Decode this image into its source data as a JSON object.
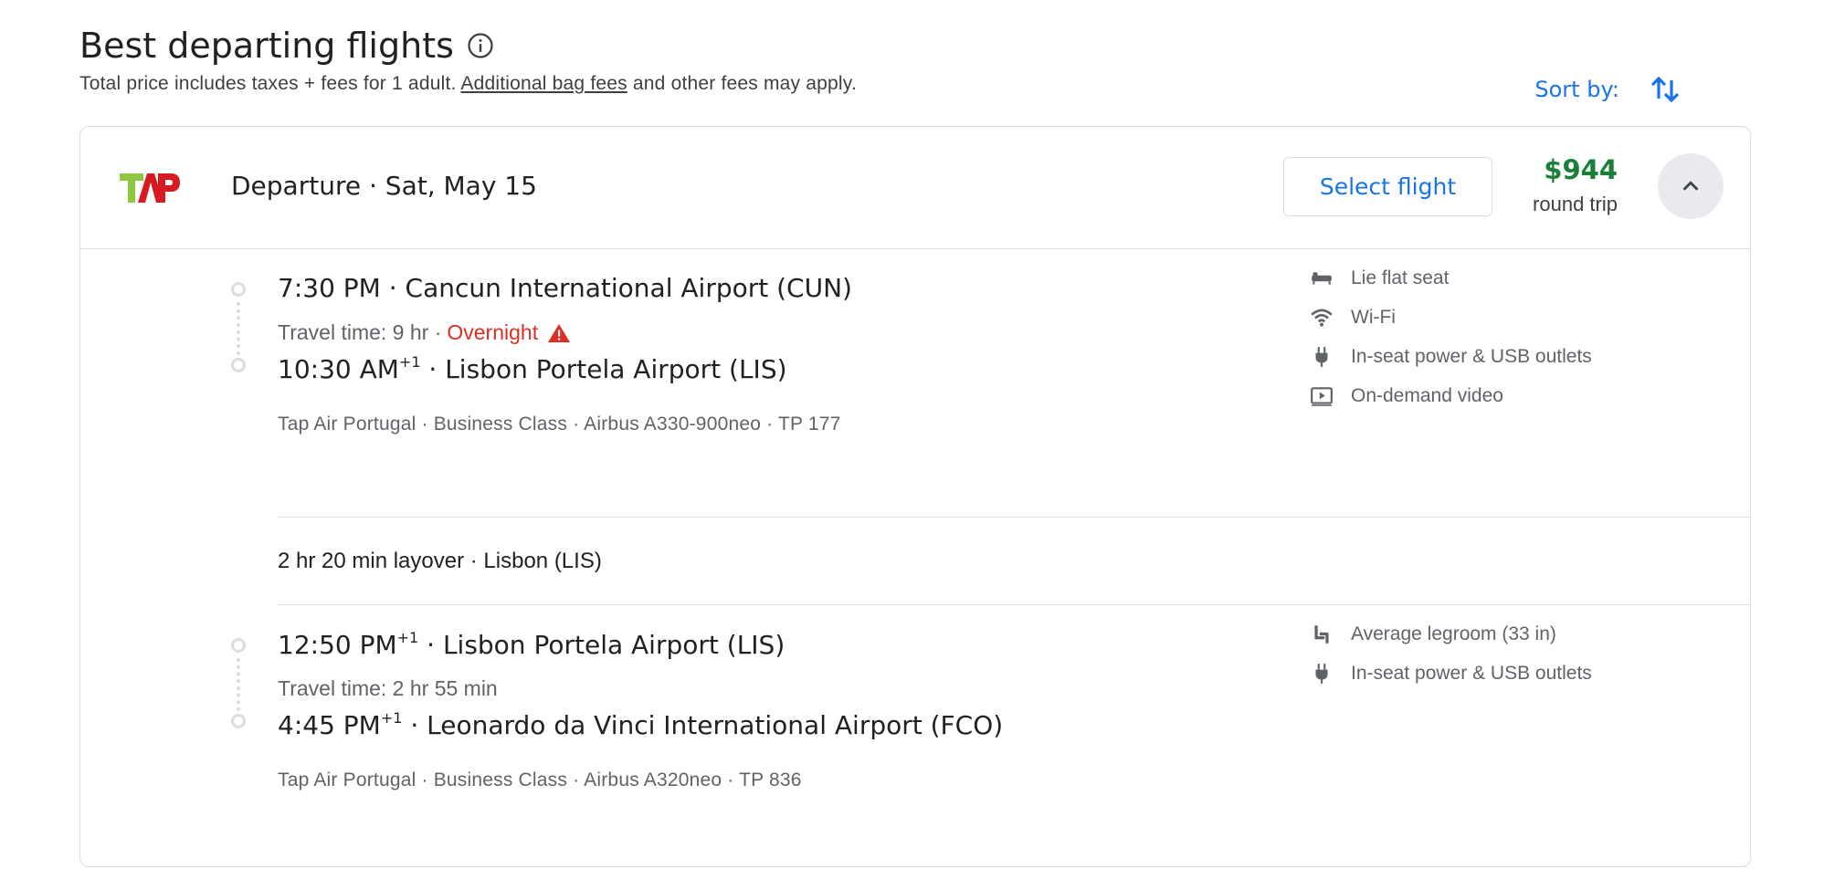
{
  "header": {
    "title": "Best departing flights",
    "subtitle_prefix": "Total price includes taxes + fees for 1 adult.",
    "subtitle_link": "Additional bag fees",
    "subtitle_suffix": "and other fees may apply.",
    "sort_label": "Sort by:"
  },
  "card": {
    "airline_logo": "TAP",
    "departure_label": "Departure",
    "date": "Sat, May 15",
    "select_label": "Select flight",
    "price": "$944",
    "price_sub": "round trip",
    "colors": {
      "accent": "#1a73e8",
      "price": "#188038",
      "warning": "#d93025"
    }
  },
  "segments": [
    {
      "dep_time": "7:30 PM",
      "dep_sup": "",
      "dep_airport": "Cancun International Airport (CUN)",
      "travel_time": "Travel time: 9 hr",
      "overnight": "Overnight",
      "arr_time": "10:30 AM",
      "arr_sup": "+1",
      "arr_airport": "Lisbon Portela Airport (LIS)",
      "details": "Tap Air Portugal · Business Class · Airbus A330-900neo · TP 177",
      "amenities": [
        {
          "icon": "lie-flat-seat-icon",
          "label": "Lie flat seat"
        },
        {
          "icon": "wifi-icon",
          "label": "Wi-Fi"
        },
        {
          "icon": "power-plug-icon",
          "label": "In-seat power & USB outlets"
        },
        {
          "icon": "video-icon",
          "label": "On-demand video"
        }
      ]
    },
    {
      "dep_time": "12:50 PM",
      "dep_sup": "+1",
      "dep_airport": "Lisbon Portela Airport (LIS)",
      "travel_time": "Travel time: 2 hr 55 min",
      "arr_time": "4:45 PM",
      "arr_sup": "+1",
      "arr_airport": "Leonardo da Vinci International Airport (FCO)",
      "details": "Tap Air Portugal · Business Class · Airbus A320neo · TP 836",
      "amenities": [
        {
          "icon": "legroom-seat-icon",
          "label": "Average legroom (33 in)"
        },
        {
          "icon": "power-plug-icon",
          "label": "In-seat power & USB outlets"
        }
      ]
    }
  ],
  "layover": "2 hr 20 min layover · Lisbon (LIS)"
}
